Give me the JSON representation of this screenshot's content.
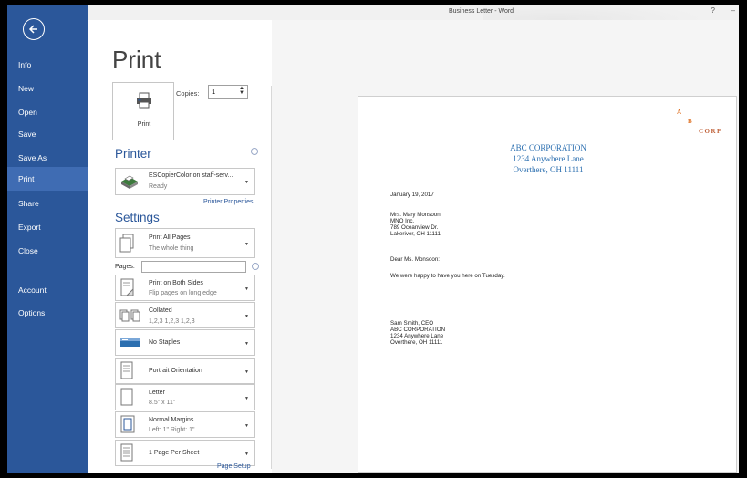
{
  "window": {
    "title": "Business Letter - Word",
    "ctrl_help": "?",
    "ctrl_min": "–"
  },
  "sidebar": {
    "items": [
      {
        "label": "Info"
      },
      {
        "label": "New"
      },
      {
        "label": "Open"
      },
      {
        "label": "Save"
      },
      {
        "label": "Save As"
      },
      {
        "label": "Print"
      },
      {
        "label": "Share"
      },
      {
        "label": "Export"
      },
      {
        "label": "Close"
      },
      {
        "label": "Account"
      },
      {
        "label": "Options"
      }
    ],
    "active": "Print"
  },
  "print": {
    "heading": "Print",
    "button_label": "Print",
    "copies_label": "Copies:",
    "copies_value": "1"
  },
  "printer": {
    "section_title": "Printer",
    "name": "ESCopierColor on staff-serv...",
    "status": "Ready",
    "properties_link": "Printer Properties"
  },
  "settings": {
    "section_title": "Settings",
    "pages_label": "Pages:",
    "pages_value": "",
    "page_setup_link": "Page Setup",
    "options": [
      {
        "title": "Print All Pages",
        "sub": "The whole thing",
        "icon": "pages-icon"
      },
      {
        "title": "Print on Both Sides",
        "sub": "Flip pages on long edge",
        "icon": "duplex-icon"
      },
      {
        "title": "Collated",
        "sub": "1,2,3   1,2,3   1,2,3",
        "icon": "collate-icon"
      },
      {
        "title": "No Staples",
        "sub": "",
        "icon": "staple-icon"
      },
      {
        "title": "Portrait Orientation",
        "sub": "",
        "icon": "portrait-icon"
      },
      {
        "title": "Letter",
        "sub": "8.5\" x 11\"",
        "icon": "paper-size-icon"
      },
      {
        "title": "Normal Margins",
        "sub": "Left:  1\"   Right:  1\"",
        "icon": "margins-icon"
      },
      {
        "title": "1 Page Per Sheet",
        "sub": "",
        "icon": "pages-per-sheet-icon"
      }
    ]
  },
  "preview": {
    "logo": {
      "a": "A",
      "b": "B",
      "corp": "CORP"
    },
    "letterhead": [
      "ABC CORPORATION",
      "1234 Anywhere Lane",
      "Overthere, OH 11111"
    ],
    "date": "January 19, 2017",
    "recipient": [
      "Mrs. Mary Monsoon",
      "MNO Inc.",
      "789 Oceanview Dr.",
      "Lakeriver, OH 11111"
    ],
    "salutation": "Dear Ms. Monsoon:",
    "body": "We were happy to have you here on Tuesday.",
    "signature": [
      "Sam Smith, CEO",
      "ABC CORPORATION",
      "1234 Anywhere Lane",
      "Overthere, OH 11111"
    ]
  },
  "colors": {
    "accent": "#2b579a",
    "letterhead": "#2b6fb0",
    "logo": "#e0762b"
  }
}
